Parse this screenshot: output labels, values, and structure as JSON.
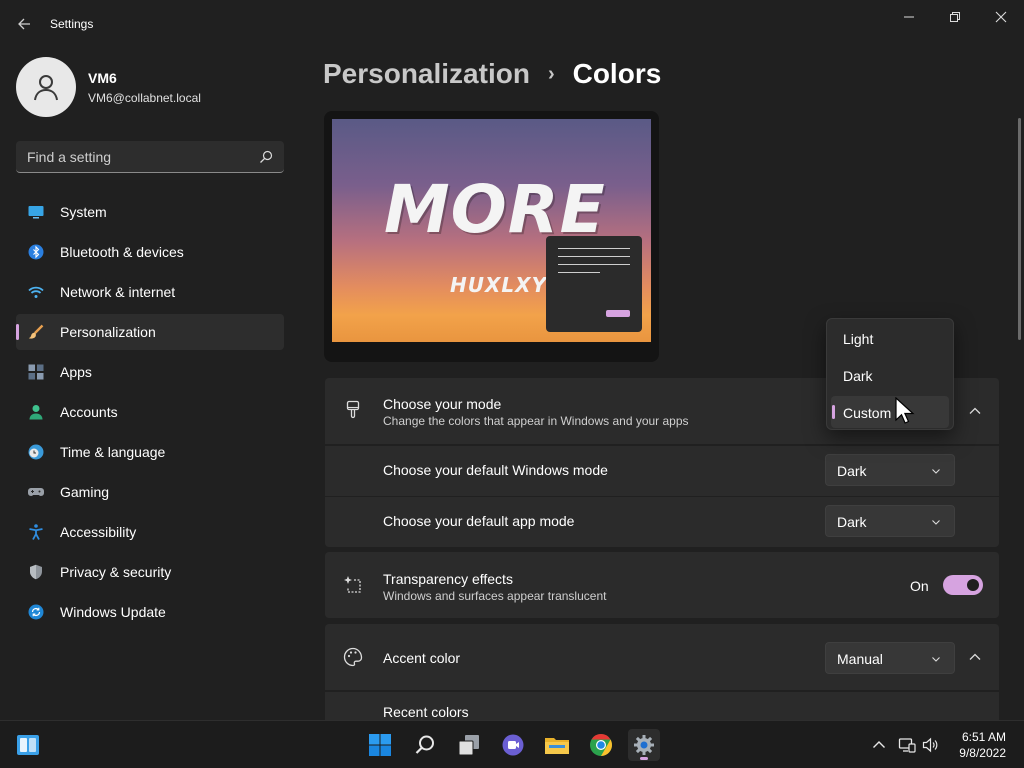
{
  "window": {
    "title": "Settings"
  },
  "user": {
    "name": "VM6",
    "email": "VM6@collabnet.local"
  },
  "search": {
    "placeholder": "Find a setting"
  },
  "sidebar": {
    "items": [
      {
        "label": "System",
        "icon": "monitor-icon"
      },
      {
        "label": "Bluetooth & devices",
        "icon": "bluetooth-icon"
      },
      {
        "label": "Network & internet",
        "icon": "wifi-icon"
      },
      {
        "label": "Personalization",
        "icon": "brush-icon",
        "active": true
      },
      {
        "label": "Apps",
        "icon": "apps-icon"
      },
      {
        "label": "Accounts",
        "icon": "person-icon"
      },
      {
        "label": "Time & language",
        "icon": "globe-clock-icon"
      },
      {
        "label": "Gaming",
        "icon": "gamepad-icon"
      },
      {
        "label": "Accessibility",
        "icon": "accessibility-icon"
      },
      {
        "label": "Privacy & security",
        "icon": "shield-icon"
      },
      {
        "label": "Windows Update",
        "icon": "update-icon"
      }
    ]
  },
  "breadcrumb": {
    "parent": "Personalization",
    "separator": "›",
    "current": "Colors"
  },
  "preview": {
    "title": "MORE",
    "subtitle": "HUXLXY"
  },
  "mode": {
    "title": "Choose your mode",
    "description": "Change the colors that appear in Windows and your apps",
    "options": [
      "Light",
      "Dark",
      "Custom"
    ],
    "selected": "Custom"
  },
  "windows_mode": {
    "label": "Choose your default Windows mode",
    "value": "Dark"
  },
  "app_mode": {
    "label": "Choose your default app mode",
    "value": "Dark"
  },
  "transparency": {
    "title": "Transparency effects",
    "description": "Windows and surfaces appear translucent",
    "state_label": "On",
    "enabled": true
  },
  "accent": {
    "title": "Accent color",
    "value": "Manual",
    "recent_colors_label": "Recent colors",
    "color": "#d6a3e0"
  },
  "taskbar": {
    "apps": [
      "start-icon",
      "search-icon",
      "task-view-icon",
      "teams-chat-icon",
      "file-explorer-icon",
      "chrome-icon",
      "settings-gear-icon"
    ],
    "time": "6:51 AM",
    "date": "9/8/2022"
  }
}
